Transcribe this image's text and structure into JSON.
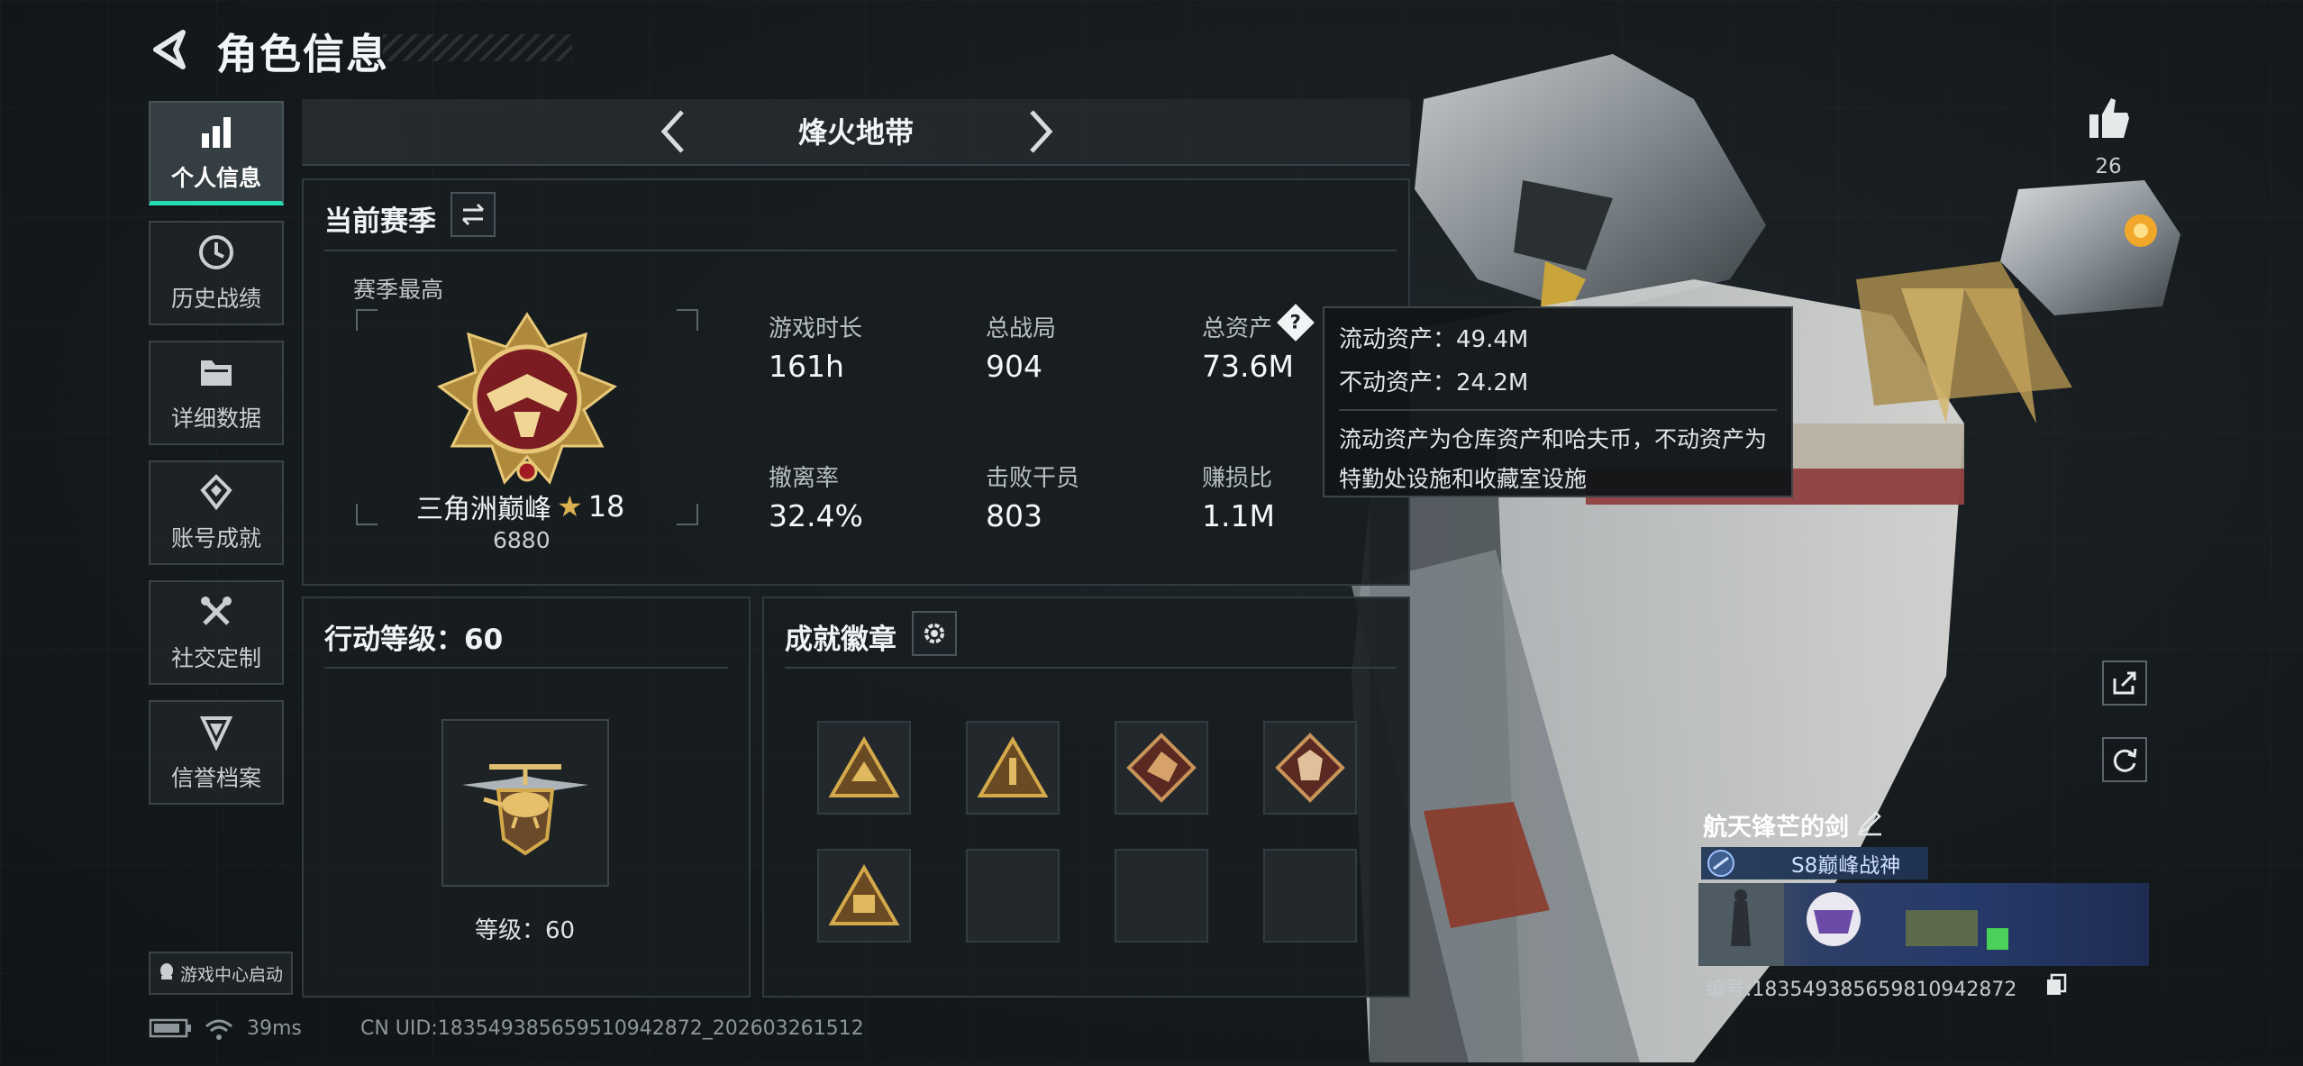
{
  "header": {
    "title": "角色信息"
  },
  "nav": [
    {
      "label": "个人信息",
      "icon": "bar-chart-icon",
      "active": true
    },
    {
      "label": "历史战绩",
      "icon": "history-icon",
      "active": false
    },
    {
      "label": "详细数据",
      "icon": "folder-icon",
      "active": false
    },
    {
      "label": "账号成就",
      "icon": "achievement-icon",
      "active": false
    },
    {
      "label": "社交定制",
      "icon": "tools-icon",
      "active": false
    },
    {
      "label": "信誉档案",
      "icon": "credit-icon",
      "active": false
    }
  ],
  "game_center": {
    "label": "游戏中心启动"
  },
  "mode": {
    "label": "烽火地带"
  },
  "season": {
    "title": "当前赛季",
    "best_label": "赛季最高",
    "rank_name": "三角洲巅峰",
    "rank_stars": "18",
    "rank_score": "6880",
    "stats": [
      {
        "label": "游戏时长",
        "value": "161h"
      },
      {
        "label": "总战局",
        "value": "904"
      },
      {
        "label": "总资产",
        "value": "73.6M"
      },
      {
        "label": "撤离率",
        "value": "32.4%"
      },
      {
        "label": "击败干员",
        "value": "803"
      },
      {
        "label": "赚损比",
        "value": "1.1M"
      }
    ]
  },
  "tooltip": {
    "liquid": "流动资产：49.4M",
    "fixed": "不动资产：24.2M",
    "description": "流动资产为仓库资产和哈夫币，不动资产为特勤处设施和收藏室设施"
  },
  "level": {
    "title": "行动等级：60",
    "level_label": "等级：60"
  },
  "badges": {
    "title": "成就徽章"
  },
  "profile": {
    "likes": "26",
    "player_name": "航天锋芒的剑",
    "title_badge": "S8巅峰战神",
    "card_id": "编号:1835493856598109428​72"
  },
  "status": {
    "ping": "39ms",
    "uid": "CN UID:18354938565951094287​2_202603261512"
  },
  "colors": {
    "accent": "#23e0b0",
    "gold": "#d4a94b",
    "star": "#d9b150"
  }
}
